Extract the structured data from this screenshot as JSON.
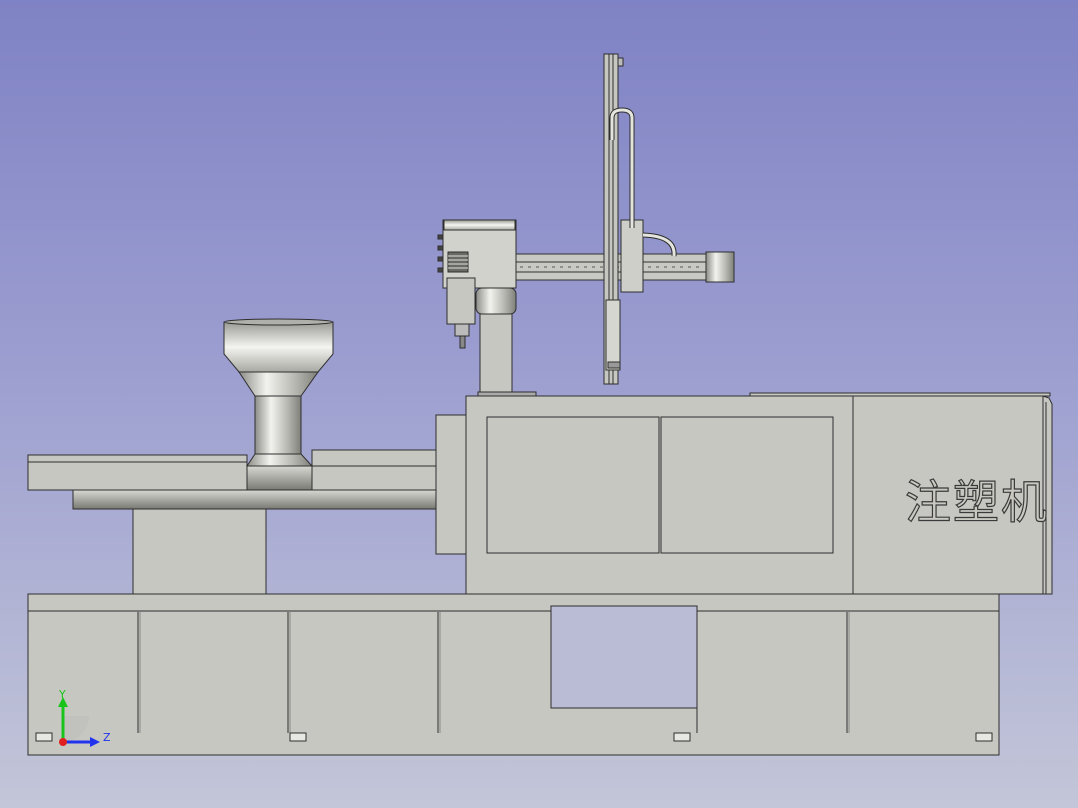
{
  "model": {
    "machine_label": "注塑机"
  },
  "triad": {
    "y_label": "Y",
    "z_label": "Z"
  },
  "colors": {
    "body": "#c7c7c1",
    "edge": "#2e2e2e",
    "background_top": "#7f82c4",
    "background_bottom": "#c3c6d8",
    "axis_y": "#19c41a",
    "axis_z": "#2233ee",
    "axis_x": "#e02020"
  }
}
